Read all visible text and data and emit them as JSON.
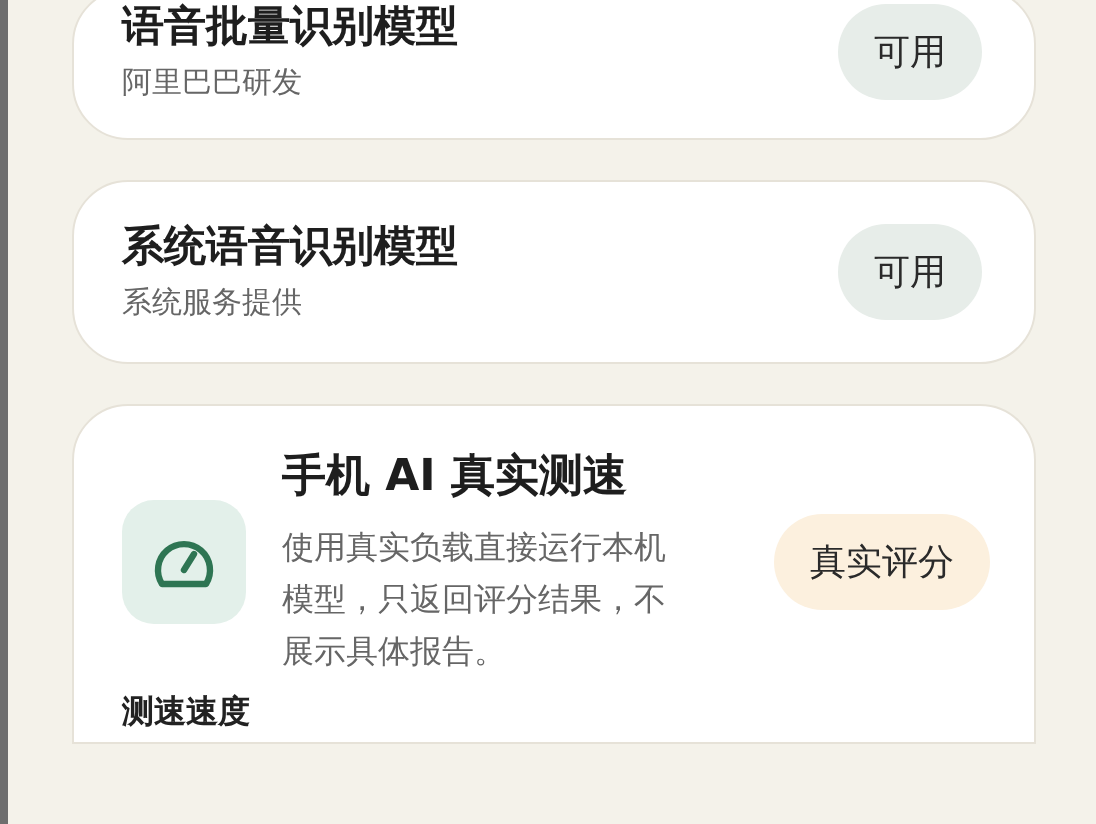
{
  "models": [
    {
      "name": "语音批量识别模型",
      "provider": "阿里巴巴研发",
      "status": "可用"
    },
    {
      "name": "系统语音识别模型",
      "provider": "系统服务提供",
      "status": "可用"
    }
  ],
  "benchmark": {
    "title": "手机 AI 真实测速",
    "description": "使用真实负载直接运行本机模型，只返回评分结果，不展示具体报告。",
    "action": "真实评分",
    "section_label": "测速速度"
  }
}
